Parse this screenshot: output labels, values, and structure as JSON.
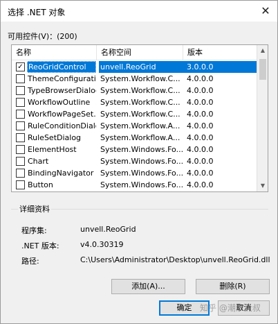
{
  "window": {
    "title": "选择 .NET 对象",
    "close_glyph": "✕"
  },
  "available": {
    "label": "可用控件(V)：(200)"
  },
  "list": {
    "columns": [
      "名称",
      "名称空间",
      "版本"
    ],
    "rows": [
      {
        "checked": true,
        "name": "ReoGridControl",
        "namespace": "unvell.ReoGrid",
        "version": "3.0.0.0",
        "selected": true
      },
      {
        "checked": false,
        "name": "ThemeConfigurati...",
        "namespace": "System.Workflow.C...",
        "version": "4.0.0.0"
      },
      {
        "checked": false,
        "name": "TypeBrowserDialog",
        "namespace": "System.Workflow.C...",
        "version": "4.0.0.0"
      },
      {
        "checked": false,
        "name": "WorkflowOutline",
        "namespace": "System.Workflow.C...",
        "version": "4.0.0.0"
      },
      {
        "checked": false,
        "name": "WorkflowPageSet...",
        "namespace": "System.Workflow.C...",
        "version": "4.0.0.0"
      },
      {
        "checked": false,
        "name": "RuleConditionDialog",
        "namespace": "System.Workflow.A...",
        "version": "4.0.0.0"
      },
      {
        "checked": false,
        "name": "RuleSetDialog",
        "namespace": "System.Workflow.A...",
        "version": "4.0.0.0"
      },
      {
        "checked": false,
        "name": "ElementHost",
        "namespace": "System.Windows.Fo...",
        "version": "4.0.0.0"
      },
      {
        "checked": false,
        "name": "Chart",
        "namespace": "System.Windows.Fo...",
        "version": "4.0.0.0"
      },
      {
        "checked": false,
        "name": "BindingNavigator",
        "namespace": "System.Windows.Fo...",
        "version": "4.0.0.0"
      },
      {
        "checked": false,
        "name": "Button",
        "namespace": "System.Windows.Fo...",
        "version": "4.0.0.0"
      }
    ]
  },
  "details": {
    "legend": "详细资料",
    "assembly_label": "程序集:",
    "assembly_value": "unvell.ReoGrid",
    "version_label": ".NET 版本:",
    "version_value": "v4.0.30319",
    "path_label": "路径:",
    "path_value": "C:\\Users\\Administrator\\Desktop\\unvell.ReoGrid.dll"
  },
  "buttons": {
    "add": "添加(A)...",
    "remove": "删除(R)",
    "ok": "确定",
    "cancel": "取消"
  },
  "watermark": "知乎 @潮汐大叔",
  "colors": {
    "selection": "#0078d7",
    "dialog_bg": "#f0f0f0"
  }
}
